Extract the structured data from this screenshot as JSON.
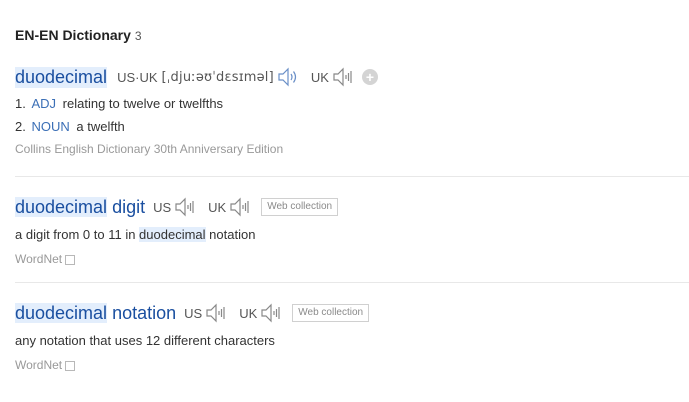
{
  "header": {
    "title": "EN-EN Dictionary",
    "count": "3"
  },
  "entries": [
    {
      "headword": "duodecimal",
      "us_label": "US·UK",
      "phonetic": "[ˌdjuːəʊˈdɛsɪməl]",
      "uk_label": "UK",
      "senses": [
        {
          "num": "1.",
          "pos": "ADJ",
          "text": "relating to twelve or twelfths"
        },
        {
          "num": "2.",
          "pos": "NOUN",
          "text": "a twelfth"
        }
      ],
      "source": "Collins English Dictionary 30th Anniversary Edition"
    },
    {
      "headword_highlight": "duodecimal",
      "headword_rest": " digit",
      "us_label": "US",
      "uk_label": "UK",
      "tag": "Web collection",
      "def_before": "a digit from 0 to 11 in ",
      "def_highlight": "duodecimal",
      "def_after": " notation",
      "source": "WordNet"
    },
    {
      "headword_highlight": "duodecimal",
      "headword_rest": " notation",
      "us_label": "US",
      "uk_label": "UK",
      "tag": "Web collection",
      "def": "any notation that uses 12 different characters",
      "source": "WordNet"
    }
  ],
  "icons": {
    "speaker": "speaker-icon",
    "add": "add-icon",
    "copy": "copy-icon"
  }
}
